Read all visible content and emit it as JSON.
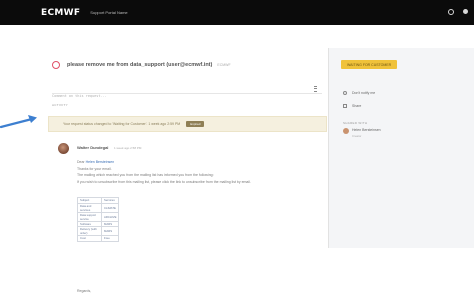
{
  "header": {
    "logo": "ECMWF",
    "portal_name": "Support Portal Name"
  },
  "request": {
    "title": "please remove me from data_support (user@ecmwf.int)",
    "meta": "ECMWF",
    "comment_placeholder": "Comment on this request...",
    "activity_label": "ACTIVITY",
    "notice_text": "Your request status changed to 'Waiting for Customer'. 1 week ago 2:59 PM",
    "notice_badge": "Expired"
  },
  "comment": {
    "author": "Walter Dundegal",
    "date": "1 week ago 2:58 PM",
    "greeting": "Dear",
    "greeting_name": "Helen Bersteinsen",
    "thanks_line": "Thanks for your email.",
    "body_lines": [
      "The mailing which reached you from the mailing list has informed you from the following:",
      "If you wish to unsubscribe from this mailing list, please click the link to unsubscribe from the mailing list by email."
    ],
    "table": [
      {
        "key": "Subject",
        "value": "Services"
      },
      {
        "key": "Data and services",
        "value": "CLIMATE"
      },
      {
        "key": "Data support service",
        "value": "ARCHIVE"
      },
      {
        "key": "Software",
        "value": "MARS"
      },
      {
        "key": "Delivery (with order)",
        "value": "MARS"
      },
      {
        "key": "Cost",
        "value": "Free"
      }
    ],
    "closing": "Regards,"
  },
  "sidebar": {
    "status_label": "WAITING FOR CUSTOMER",
    "items": [
      {
        "label": "Don't notify me",
        "icon": "bell-icon"
      },
      {
        "label": "Share",
        "icon": "share-icon"
      }
    ],
    "shared_label": "SHARED WITH",
    "shared_name": "Helen Bersteinsen",
    "shared_sub": "Creator"
  },
  "colors": {
    "topbar": "#0b0b0b",
    "status_button": "#f0c23a",
    "notice_bg": "#f5f0df",
    "arrow": "#3d7fd0"
  }
}
